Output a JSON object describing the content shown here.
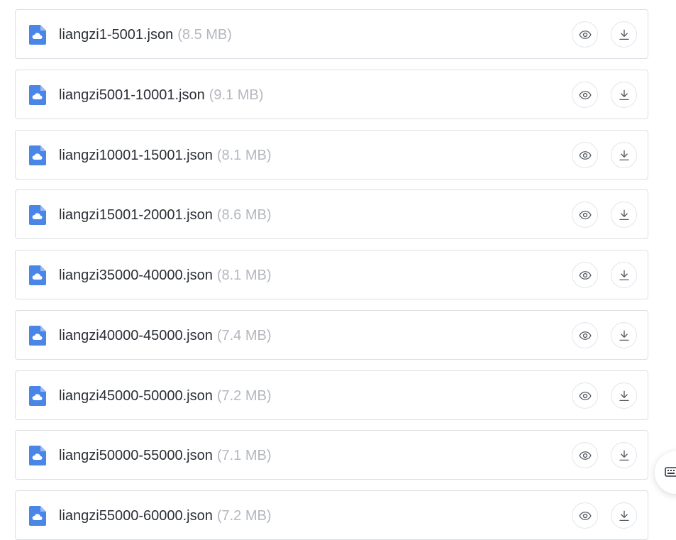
{
  "files": [
    {
      "name": "liangzi1-5001.json",
      "size": "(8.5 MB)"
    },
    {
      "name": "liangzi5001-10001.json",
      "size": "(9.1 MB)"
    },
    {
      "name": "liangzi10001-15001.json",
      "size": "(8.1 MB)"
    },
    {
      "name": "liangzi15001-20001.json",
      "size": "(8.6 MB)"
    },
    {
      "name": "liangzi35000-40000.json",
      "size": "(8.1 MB)"
    },
    {
      "name": "liangzi40000-45000.json",
      "size": "(7.4 MB)"
    },
    {
      "name": "liangzi45000-50000.json",
      "size": "(7.2 MB)"
    },
    {
      "name": "liangzi50000-55000.json",
      "size": "(7.1 MB)"
    },
    {
      "name": "liangzi55000-60000.json",
      "size": "(7.2 MB)"
    }
  ],
  "icons": {
    "file": "cloud-file-icon",
    "preview": "eye-icon",
    "download": "download-icon",
    "floating": "keyboard-icon"
  },
  "colors": {
    "file_icon": "#4a86e8",
    "file_name": "#2b2f36",
    "file_size": "#b4b8bf",
    "row_border": "#dcdfe3",
    "action_icon": "#555a61"
  }
}
